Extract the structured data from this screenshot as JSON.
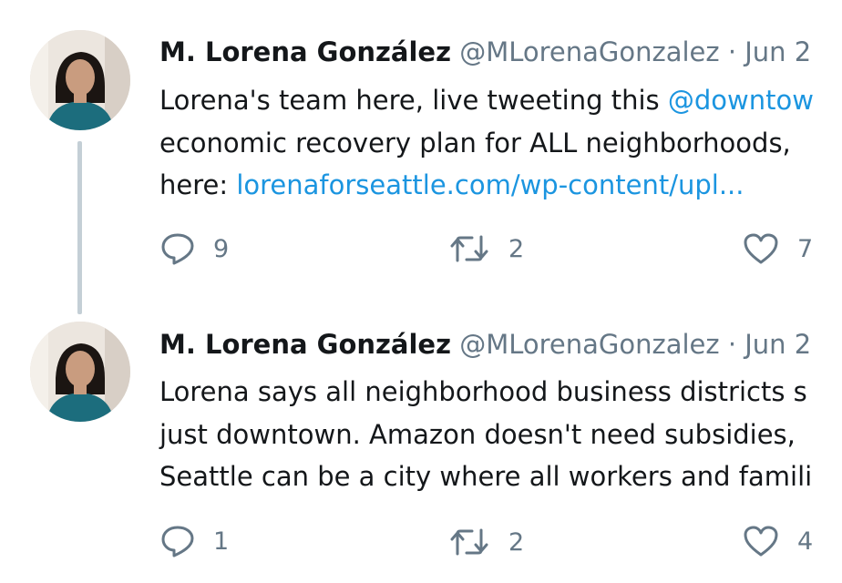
{
  "tweets": [
    {
      "author_name": "M. Lorena González",
      "handle": "@MLorenaGonzalez",
      "separator": "·",
      "date": "Jun 2",
      "lines": [
        {
          "pre": "Lorena's team here, live tweeting this ",
          "link": "@downtow",
          "post": ""
        },
        {
          "pre": "economic recovery plan for ALL neighborhoods,",
          "link": "",
          "post": ""
        },
        {
          "pre": "here: ",
          "link": "lorenaforseattle.com/wp-content/upl...",
          "post": ""
        }
      ],
      "replies": "9",
      "retweets": "2",
      "likes": "7"
    },
    {
      "author_name": "M. Lorena González",
      "handle": "@MLorenaGonzalez",
      "separator": "·",
      "date": "Jun 2",
      "lines": [
        {
          "pre": "Lorena says all neighborhood business districts s",
          "link": "",
          "post": ""
        },
        {
          "pre": "just downtown. Amazon doesn't need subsidies,",
          "link": "",
          "post": ""
        },
        {
          "pre": "Seattle can be a city where all workers and famili",
          "link": "",
          "post": ""
        }
      ],
      "replies": "1",
      "retweets": "2",
      "likes": "4"
    }
  ],
  "icons": {
    "reply": "reply-icon",
    "retweet": "retweet-icon",
    "like": "heart-icon"
  },
  "colors": {
    "link": "#1b95e0",
    "secondary_text": "#657786",
    "thread_line": "#c4cfd6"
  }
}
